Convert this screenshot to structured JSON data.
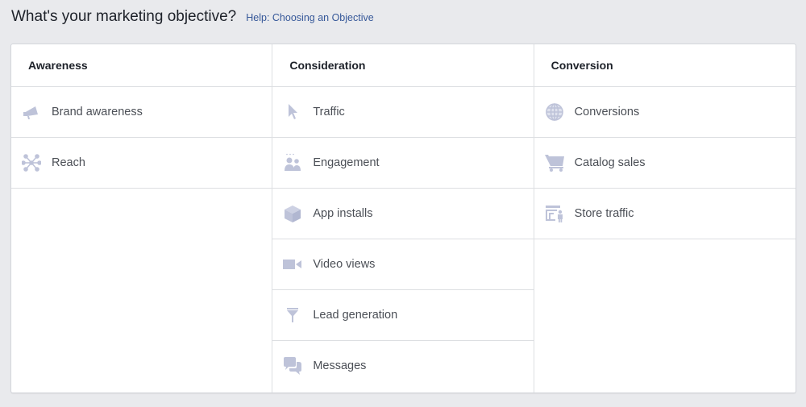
{
  "header": {
    "title": "What's your marketing objective?",
    "help_link": "Help: Choosing an Objective"
  },
  "colors": {
    "icon": "#bec3d9",
    "link": "#365899"
  },
  "columns": [
    {
      "title": "Awareness",
      "items": [
        {
          "label": "Brand awareness",
          "icon": "megaphone-icon"
        },
        {
          "label": "Reach",
          "icon": "reach-network-icon"
        }
      ]
    },
    {
      "title": "Consideration",
      "items": [
        {
          "label": "Traffic",
          "icon": "cursor-icon"
        },
        {
          "label": "Engagement",
          "icon": "people-icon"
        },
        {
          "label": "App installs",
          "icon": "box-icon"
        },
        {
          "label": "Video views",
          "icon": "video-camera-icon"
        },
        {
          "label": "Lead generation",
          "icon": "funnel-icon"
        },
        {
          "label": "Messages",
          "icon": "chat-bubbles-icon"
        }
      ]
    },
    {
      "title": "Conversion",
      "items": [
        {
          "label": "Conversions",
          "icon": "globe-icon"
        },
        {
          "label": "Catalog sales",
          "icon": "cart-icon"
        },
        {
          "label": "Store traffic",
          "icon": "store-icon"
        }
      ]
    }
  ]
}
